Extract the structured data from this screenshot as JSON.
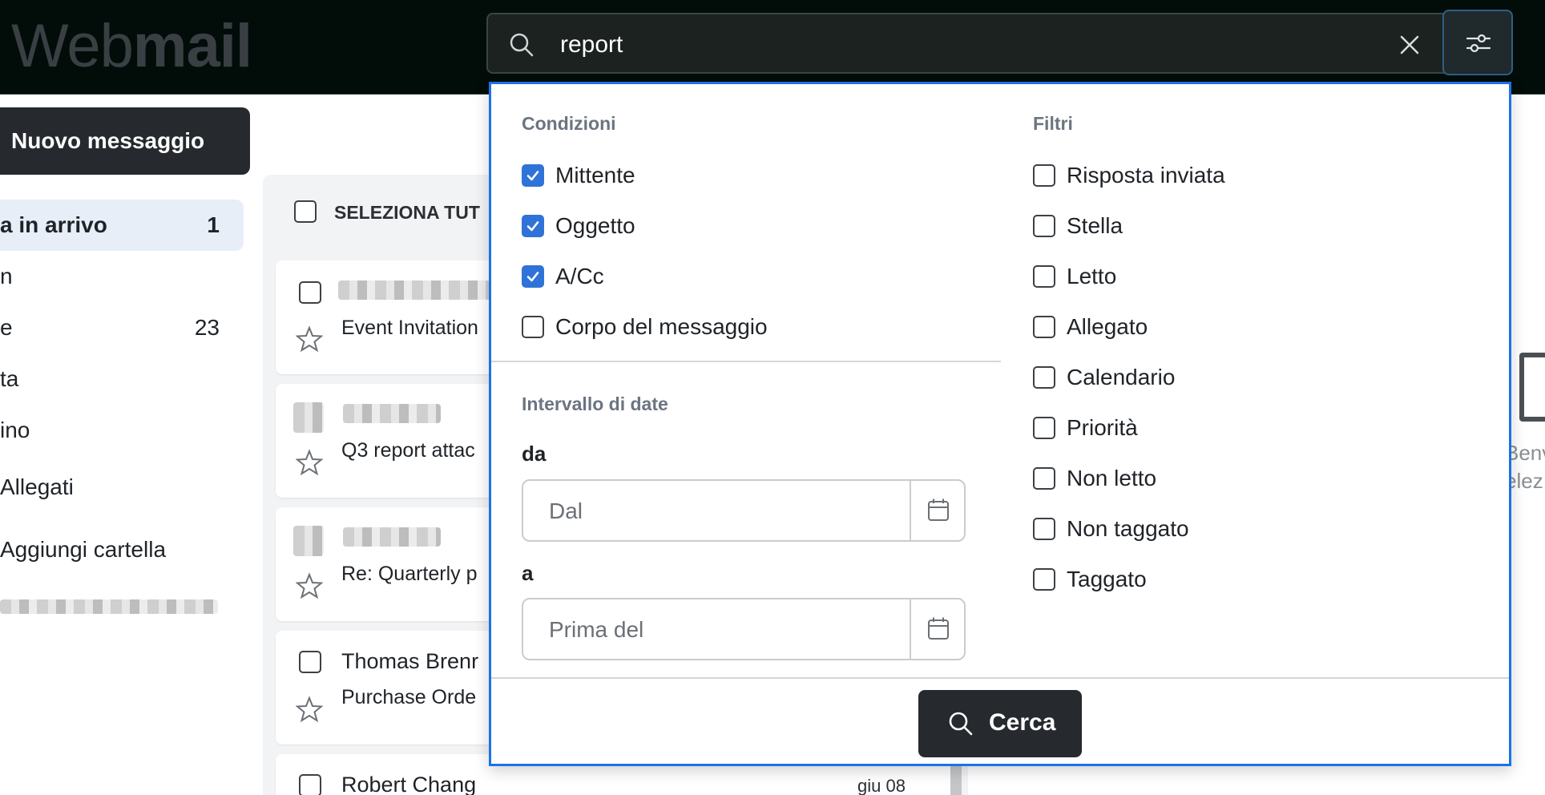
{
  "app": {
    "logo_light": "Web",
    "logo_bold": "mail"
  },
  "search": {
    "query": "report"
  },
  "sidebar": {
    "new_message": "Nuovo messaggio",
    "items": [
      {
        "label": "a in arrivo",
        "count": "1"
      },
      {
        "label": "n",
        "count": ""
      },
      {
        "label": "e",
        "count": "23"
      },
      {
        "label": "ta",
        "count": ""
      },
      {
        "label": "ino",
        "count": ""
      },
      {
        "label": "Allegati",
        "count": ""
      },
      {
        "label": "Aggiungi cartella",
        "count": ""
      }
    ]
  },
  "list": {
    "select_all": "SELEZIONA TUT",
    "messages": [
      {
        "from": "",
        "subject": "Event Invitation",
        "date": ""
      },
      {
        "from": "",
        "subject": "Q3 report attac",
        "date": ""
      },
      {
        "from": "",
        "subject": "Re: Quarterly p",
        "date": ""
      },
      {
        "from": "Thomas Brenr",
        "subject": "Purchase Orde",
        "date": ""
      },
      {
        "from": "Robert Chang",
        "subject": "",
        "date": "giu 08"
      }
    ]
  },
  "pane": {
    "line1": "Benv",
    "line2": "elez"
  },
  "dropdown": {
    "conditions_title": "Condizioni",
    "conditions": [
      {
        "label": "Mittente",
        "checked": true
      },
      {
        "label": "Oggetto",
        "checked": true
      },
      {
        "label": "A/Cc",
        "checked": true
      },
      {
        "label": "Corpo del messaggio",
        "checked": false
      }
    ],
    "date_range_title": "Intervallo di date",
    "from_label": "da",
    "from_placeholder": "Dal",
    "to_label": "a",
    "to_placeholder": "Prima del",
    "filters_title": "Filtri",
    "filters": [
      {
        "label": "Risposta inviata",
        "checked": false
      },
      {
        "label": "Stella",
        "checked": false
      },
      {
        "label": "Letto",
        "checked": false
      },
      {
        "label": "Allegato",
        "checked": false
      },
      {
        "label": "Calendario",
        "checked": false
      },
      {
        "label": "Priorità",
        "checked": false
      },
      {
        "label": "Non letto",
        "checked": false
      },
      {
        "label": "Non taggato",
        "checked": false
      },
      {
        "label": "Taggato",
        "checked": false
      }
    ],
    "search_button": "Cerca"
  },
  "colors": {
    "accent": "#1a73e8",
    "checkbox": "#2f73d8",
    "topbar": "#020d0a",
    "dark_button": "#262a2e"
  },
  "icons": [
    "search-icon",
    "close-icon",
    "filter-sliders-icon",
    "calendar-icon",
    "star-icon",
    "checkmark-icon",
    "mail-icon"
  ]
}
